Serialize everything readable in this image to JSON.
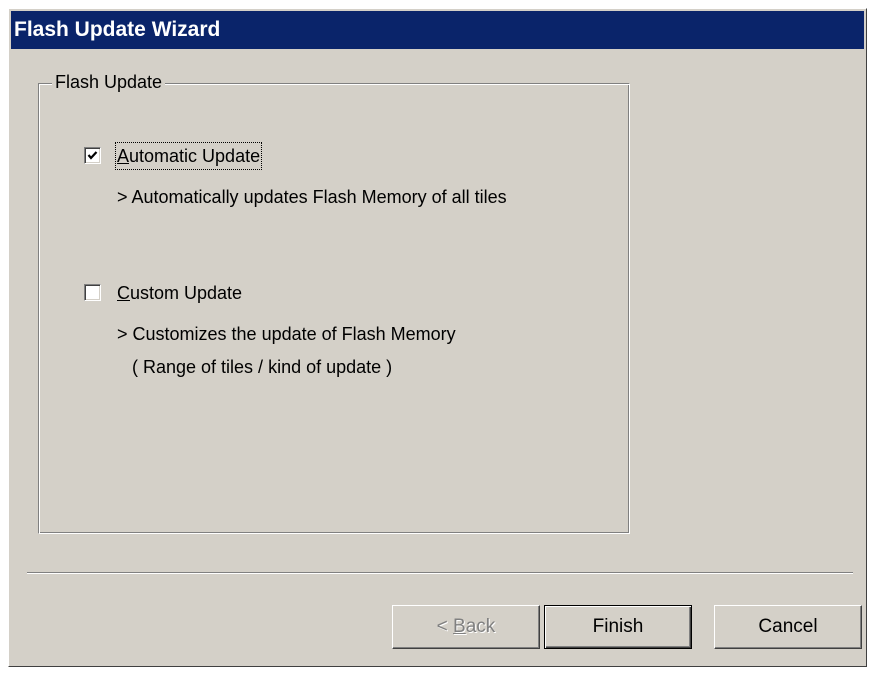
{
  "window": {
    "title": "Flash Update Wizard"
  },
  "group": {
    "label": "Flash Update",
    "options": [
      {
        "label_mnemonic": "A",
        "label_rest": "utomatic Update",
        "checked": true,
        "description": [
          "> Automatically updates Flash Memory of all tiles"
        ]
      },
      {
        "label_mnemonic": "C",
        "label_rest": "ustom Update",
        "checked": false,
        "description": [
          "> Customizes the update of Flash Memory",
          "( Range of tiles / kind of update )"
        ]
      }
    ]
  },
  "buttons": {
    "back": {
      "prefix": "< ",
      "mnemonic": "B",
      "rest": "ack",
      "enabled": false
    },
    "finish": {
      "label": "Finish",
      "enabled": true,
      "default": true
    },
    "cancel": {
      "label": "Cancel",
      "enabled": true
    }
  },
  "colors": {
    "titlebar": "#0a246a",
    "face": "#d4d0c8"
  }
}
